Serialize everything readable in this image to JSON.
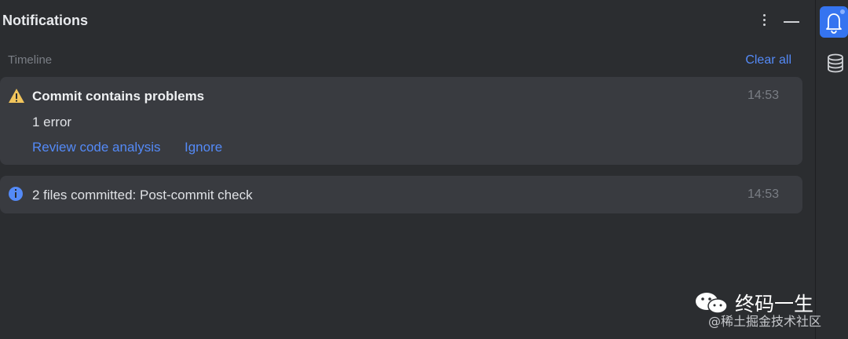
{
  "panel": {
    "title": "Notifications",
    "menu_icon": "more-vertical-icon",
    "minimize_icon": "minimize-icon"
  },
  "timeline": {
    "label": "Timeline",
    "clear_all": "Clear all"
  },
  "notifications": [
    {
      "icon": "warning-icon",
      "title": "Commit contains problems",
      "time": "14:53",
      "body": "1 error",
      "actions": [
        "Review code analysis",
        "Ignore"
      ]
    },
    {
      "icon": "info-icon",
      "title": "2 files committed: Post-commit check",
      "time": "14:53"
    }
  ],
  "right_toolbar": {
    "items": [
      "notifications-bell-icon",
      "database-icon"
    ]
  },
  "watermark": {
    "name": "终码一生",
    "sub": "@稀土掘金技术社区"
  },
  "colors": {
    "background": "#2b2d30",
    "card": "#393b40",
    "link": "#548af7",
    "warning": "#f2c55c",
    "info": "#548af7",
    "active_tool": "#3574f0"
  }
}
